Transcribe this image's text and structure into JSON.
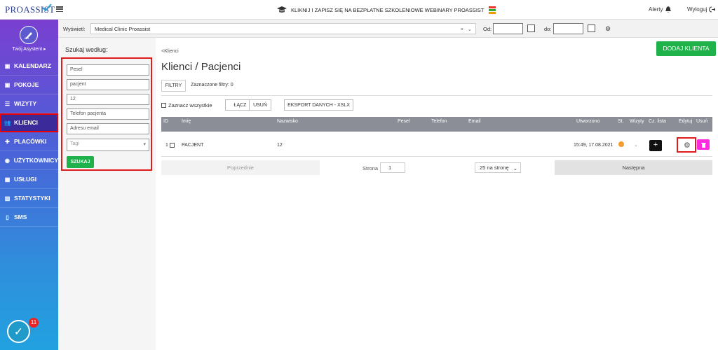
{
  "header": {
    "logo": "PROASSIST",
    "banner": "KLIKNIJ I ZAPISZ SIĘ NA BEZPŁATNE SZKOLENIOWE WEBINARY PROASSIST",
    "alerts": "Alerty",
    "logout": "Wyloguj"
  },
  "sidebar": {
    "assistant": "Twój Asystent ▸",
    "items": [
      {
        "label": "KALENDARZ",
        "icon": "calendar-icon"
      },
      {
        "label": "POKOJE",
        "icon": "calendar-icon"
      },
      {
        "label": "WIZYTY",
        "icon": "list-icon"
      },
      {
        "label": "KLIENCI",
        "icon": "users-icon",
        "active": true
      },
      {
        "label": "PLACÓWKI",
        "icon": "user-plus-icon"
      },
      {
        "label": "UŻYTKOWNICY",
        "icon": "user-circle-icon"
      },
      {
        "label": "USŁUGI",
        "icon": "grid-icon"
      },
      {
        "label": "STATYSTYKI",
        "icon": "bar-chart-icon"
      },
      {
        "label": "SMS",
        "icon": "phone-icon"
      }
    ],
    "notification_count": "11"
  },
  "filterbar": {
    "show_label": "Wyświetl:",
    "location": "Medical Clinic Proassist",
    "from_label": "Od:",
    "to_label": "do:"
  },
  "search": {
    "title": "Szukaj według:",
    "fields": [
      {
        "value": "Pesel",
        "kind": "placeholder"
      },
      {
        "value": "pacjent",
        "kind": "value"
      },
      {
        "value": "12",
        "kind": "value"
      },
      {
        "value": "Telefon pacjenta",
        "kind": "placeholder"
      },
      {
        "value": "Adresu email",
        "kind": "placeholder"
      }
    ],
    "tags_placeholder": "Tagi",
    "submit": "SZUKAJ"
  },
  "main": {
    "back": "<Klienci",
    "title": "Klienci / Pacjenci",
    "add_client": "DODAJ KLIENTA",
    "filters_button": "FILTRY",
    "filters_count": "Zaznaczone filtry: 0",
    "select_all": "Zaznacz wszystkie",
    "actions": [
      "ŁĄCZ",
      "USUŃ",
      "EKSPORT DANYCH - XSLX"
    ]
  },
  "table": {
    "columns": [
      "ID",
      "Imię",
      "Nazwisko",
      "Pesel",
      "Telefon",
      "Email",
      "Utworzono",
      "St.",
      "Wizyty",
      "Cz. lista",
      "Edytuj",
      "Usuń"
    ],
    "rows": [
      {
        "id": "1",
        "first_name": "PACJENT",
        "last_name": "12",
        "pesel": "",
        "phone": "",
        "email": "",
        "created": "15:49, 17.08.2021",
        "status_color": "#f39b2f",
        "lista": "+"
      }
    ]
  },
  "pager": {
    "prev": "Poprzednie",
    "page_label": "Strona",
    "page": "1",
    "per_page": "25 na stronę",
    "next": "Następna"
  }
}
